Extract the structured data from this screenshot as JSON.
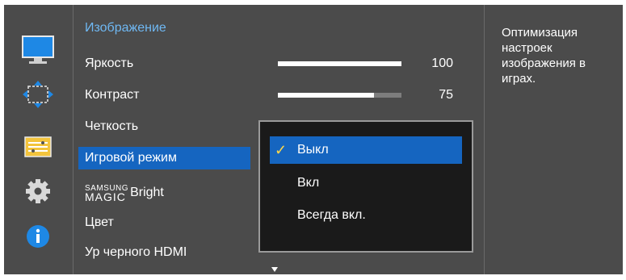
{
  "menu": {
    "title": "Изображение",
    "items": [
      {
        "label": "Яркость",
        "value": "100",
        "fraction": 1.0
      },
      {
        "label": "Контраст",
        "value": "75",
        "fraction": 0.78
      },
      {
        "label": "Четкость"
      },
      {
        "label": "Игровой режим"
      },
      {
        "label_top": "SAMSUNG",
        "label_bottom": "MAGIC",
        "label_main": "Bright"
      },
      {
        "label": "Цвет"
      },
      {
        "label": "Ур черного HDMI"
      }
    ]
  },
  "submenu": {
    "options": [
      {
        "label": "Выкл",
        "checked": true
      },
      {
        "label": "Вкл"
      },
      {
        "label": "Всегда вкл."
      }
    ]
  },
  "description": "Оптимизация настроек изображения в играх.",
  "sidebar": {
    "icons": [
      "monitor-icon",
      "move-arrows-icon",
      "menu-settings-icon",
      "gear-icon",
      "info-icon"
    ]
  },
  "colors": {
    "background": "#4b4b4b",
    "accent_title": "#6fb8f3",
    "selected_bg": "#1565c0",
    "check": "#ffd84a"
  }
}
